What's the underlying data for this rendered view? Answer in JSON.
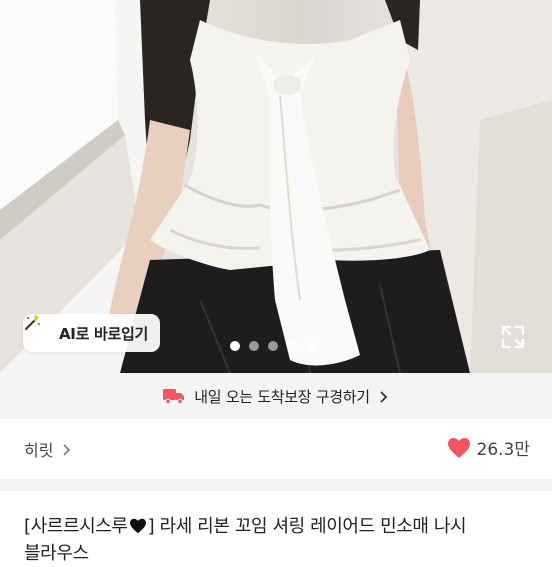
{
  "photo": {
    "ai_button_label": "AI로 바로입기",
    "carousel": {
      "total": 5,
      "active_index": 0
    }
  },
  "banner": {
    "text": "내일 오는 도착보장 구경하기"
  },
  "seller": {
    "name": "히릿"
  },
  "likes": {
    "count": "26.3만"
  },
  "product": {
    "title_prefix": "[사르르시스루",
    "title_suffix": "] 라세 리본 꼬임 셔링 레이어드 민소매 나시",
    "title_line2": "블라우스"
  },
  "colors": {
    "accent": "#f05660",
    "banner_bg": "#f4f4f6"
  }
}
